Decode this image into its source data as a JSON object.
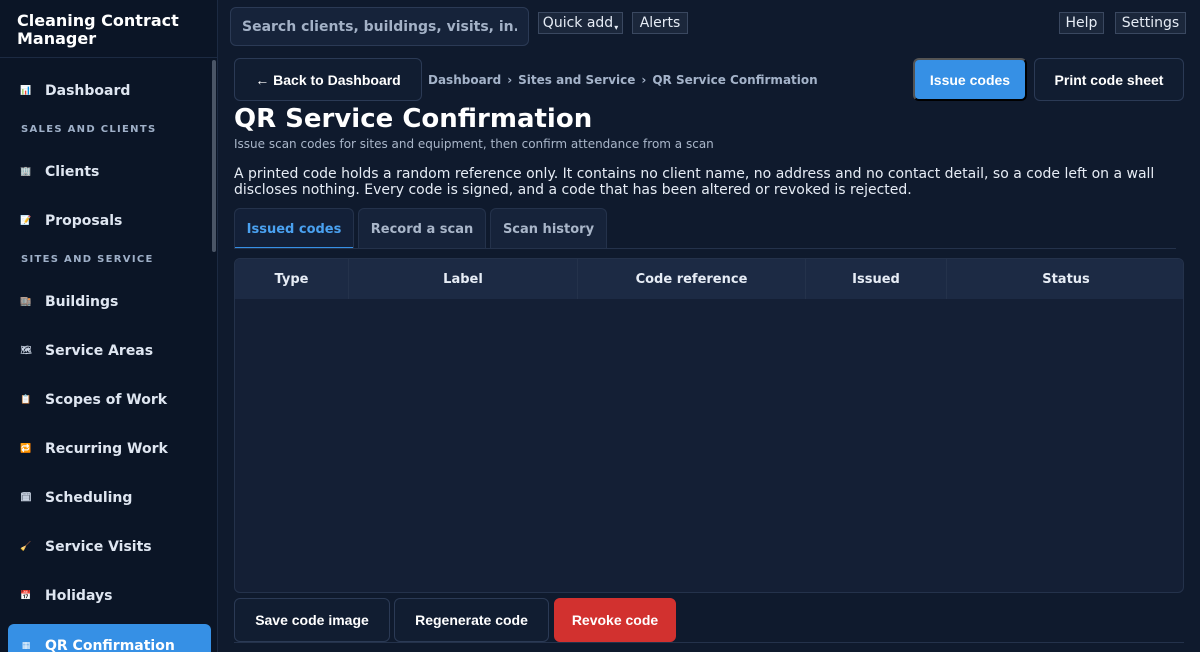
{
  "app": {
    "title": "Cleaning Contract Manager"
  },
  "sidebar": {
    "dashboard": {
      "label": "Dashboard",
      "icon": "bar-chart-icon"
    },
    "sections": [
      {
        "title": "SALES AND CLIENTS",
        "items": [
          {
            "label": "Clients",
            "icon": "office-building-icon"
          },
          {
            "label": "Proposals",
            "icon": "memo-icon"
          }
        ]
      },
      {
        "title": "SITES AND SERVICE",
        "items": [
          {
            "label": "Buildings",
            "icon": "buildings-icon"
          },
          {
            "label": "Service Areas",
            "icon": "map-icon"
          },
          {
            "label": "Scopes of Work",
            "icon": "clipboard-icon"
          },
          {
            "label": "Recurring Work",
            "icon": "repeat-icon"
          },
          {
            "label": "Scheduling",
            "icon": "calendar-spiral-icon"
          },
          {
            "label": "Service Visits",
            "icon": "broom-icon"
          },
          {
            "label": "Holidays",
            "icon": "calendar-icon"
          },
          {
            "label": "QR Confirmation",
            "icon": "qr-icon",
            "active": true
          }
        ]
      }
    ]
  },
  "topbar": {
    "search_placeholder": "Search clients, buildings, visits, in...",
    "quick_add": "Quick add",
    "alerts": "Alerts",
    "help": "Help",
    "settings": "Settings"
  },
  "header": {
    "back": "← Back to Dashboard",
    "breadcrumb": [
      "Dashboard",
      "Sites and Service",
      "QR Service Confirmation"
    ],
    "breadcrumb_sep": "›",
    "issue_codes": "Issue codes",
    "print_sheet": "Print code sheet",
    "title": "QR Service Confirmation",
    "subtitle": "Issue scan codes for sites and equipment, then confirm attendance from a scan",
    "description": "A printed code holds a random reference only. It contains no client name, no address and no contact detail, so a code left on a wall discloses nothing. Every code is signed, and a code that has been altered or revoked is rejected."
  },
  "tabs": [
    {
      "label": "Issued codes",
      "active": true
    },
    {
      "label": "Record a scan"
    },
    {
      "label": "Scan history"
    }
  ],
  "table": {
    "columns": [
      "Type",
      "Label",
      "Code reference",
      "Issued",
      "Status"
    ],
    "rows": []
  },
  "footer": {
    "save_image": "Save code image",
    "regenerate": "Regenerate code",
    "revoke": "Revoke code"
  },
  "colors": {
    "accent": "#3690e5",
    "danger": "#d2312f",
    "background": "#0f1a2d",
    "sidebar": "#0b1526"
  }
}
